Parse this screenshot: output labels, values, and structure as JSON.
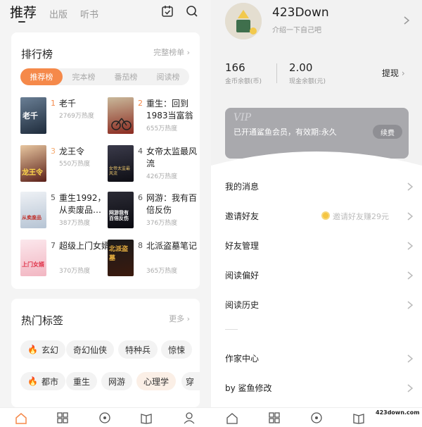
{
  "left": {
    "tabs": {
      "main": "推荐",
      "publish": "出版",
      "audio": "听书"
    },
    "ranking": {
      "title": "排行榜",
      "more": "完整榜单",
      "segments": [
        "推荐榜",
        "完本榜",
        "番茄榜",
        "阅读榜"
      ],
      "books": [
        {
          "rank": "1",
          "title": "老千",
          "heat": "2769万热度",
          "cover_text": "老千"
        },
        {
          "rank": "2",
          "title": "重生：回到1983当富翁",
          "heat": "655万热度",
          "cover_text": ""
        },
        {
          "rank": "3",
          "title": "龙王令",
          "heat": "550万热度",
          "cover_text": "龙王令"
        },
        {
          "rank": "4",
          "title": "女帝太监最风流",
          "heat": "426万热度",
          "cover_text": "女帝太监最风流"
        },
        {
          "rank": "5",
          "title": "重生1992，从卖废品…",
          "heat": "387万热度",
          "cover_text": "从卖废品"
        },
        {
          "rank": "6",
          "title": "网游：我有百倍反伤",
          "heat": "376万热度",
          "cover_text": "网游我有百倍反伤"
        },
        {
          "rank": "7",
          "title": "超级上门女婿",
          "heat": "370万热度",
          "cover_text": "上门女婿"
        },
        {
          "rank": "8",
          "title": "北派盗墓笔记",
          "heat": "365万热度",
          "cover_text": "北派盗墓"
        }
      ]
    },
    "hot_tags": {
      "title": "热门标签",
      "more": "更多",
      "row1": [
        "玄幻",
        "奇幻仙侠",
        "特种兵",
        "惊悚"
      ],
      "row2": [
        "都市",
        "重生",
        "网游",
        "心理学",
        "穿"
      ]
    }
  },
  "right": {
    "profile": {
      "name": "423Down",
      "intro": "介绍一下自己吧"
    },
    "wallet": {
      "coins_value": "166",
      "coins_label": "金币余额(币)",
      "cash_value": "2.00",
      "cash_label": "现金余额(元)",
      "withdraw": "提现"
    },
    "vip": {
      "badge": "VIP",
      "status": "已开通鲨鱼会员，有效期:永久",
      "renew": "续费"
    },
    "menu": {
      "messages": "我的消息",
      "invite": "邀请好友",
      "invite_note": "邀请好友赚29元",
      "friends": "好友管理",
      "preferences": "阅读偏好",
      "history": "阅读历史",
      "author": "作家中心",
      "by": "by 鲨鱼修改"
    }
  },
  "watermark": {
    "text": "423down.com"
  },
  "colors": {
    "accent": "#f5894a",
    "gold": "#f5c542"
  }
}
